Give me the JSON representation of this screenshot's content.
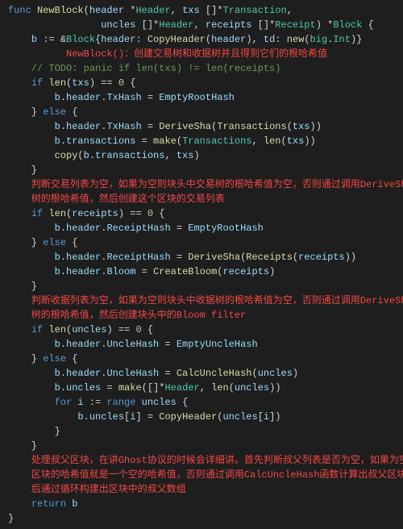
{
  "code": {
    "func_kw": "func",
    "fn_name": "NewBlock",
    "sig1": "(header *Header, txs []*Transaction,",
    "sig2": "                uncles []*Header, receipts []*Receipt) *Block {",
    "l_assign": "    b := &Block{header: CopyHeader(header), td: new(big.Int)}",
    "c_red1": "          NewBlock()：创建交易树和收据树并且得到它们的根哈希值",
    "c_todo": "    // TODO: panic if len(txs) != len(receipts)",
    "if1": "    if len(txs) == 0 {",
    "if1_body": "        b.header.TxHash = EmptyRootHash",
    "else1": "    } else {",
    "else1_l1": "        b.header.TxHash = DeriveSha(Transactions(txs))",
    "else1_l2": "        b.transactions = make(Transactions, len(txs))",
    "else1_l3": "        copy(b.transactions, txs)",
    "close1": "    }",
    "c_red2a": "    判断交易列表为空，如果为空则块头中交易树的根哈希值为空，否则通过调用DeriveSha函数得到交易",
    "c_red2b": "    树的根哈希值，然后创建这个区块的交易列表",
    "if2": "    if len(receipts) == 0 {",
    "if2_body": "        b.header.ReceiptHash = EmptyRootHash",
    "else2": "    } else {",
    "else2_l1": "        b.header.ReceiptHash = DeriveSha(Receipts(receipts))",
    "else2_l2": "        b.header.Bloom = CreateBloom(receipts)",
    "close2": "    }",
    "c_red3a": "    判断收据列表为空，如果为空则块头中收据树的根哈希值为空，否则通过调用DeriveSha函数得到收据",
    "c_red3b": "    树的根哈希值，然后创建块头中的Bloom filter",
    "if3": "    if len(uncles) == 0 {",
    "if3_body": "        b.header.UncleHash = EmptyUncleHash",
    "else3": "    } else {",
    "else3_l1": "        b.header.UncleHash = CalcUncleHash(uncles)",
    "else3_l2": "        b.uncles = make([]*Header, len(uncles))",
    "else3_l3": "        for i := range uncles {",
    "else3_l4": "            b.uncles[i] = CopyHeader(uncles[i])",
    "else3_l5": "        }",
    "close3": "    }",
    "c_red4a": "    处理叔父区块，在讲Ghost协议的时候会详细讲。首先判断叔父列表是否为空，如果为空则块头中叔父",
    "c_red4b": "    区块的哈希值就是一个空的哈希值，否则通过调用CalcUncleHash函数计算出叔父区块的根哈希值，然",
    "c_red4c": "    后通过循环构建出区块中的叔父数组",
    "ret": "    return b",
    "end": "}"
  }
}
